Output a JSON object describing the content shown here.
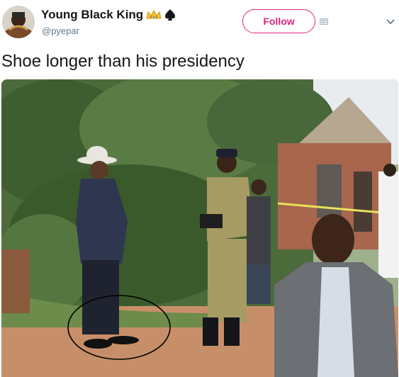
{
  "tweet": {
    "display_name": "Young Black King",
    "handle": "@pyepar",
    "follow_label": "Follow",
    "text": "Shoe longer than his presidency",
    "icons": {
      "avatar": "avatar",
      "crown": "crown-icon",
      "spade": "spade-icon",
      "badge": "badge-icon",
      "caret": "chevron-down-icon"
    },
    "colors": {
      "accent": "#e0247a",
      "text": "#14171a",
      "muted": "#657786"
    }
  },
  "media": {
    "kind": "photo",
    "annotation": "hand-drawn circle"
  }
}
